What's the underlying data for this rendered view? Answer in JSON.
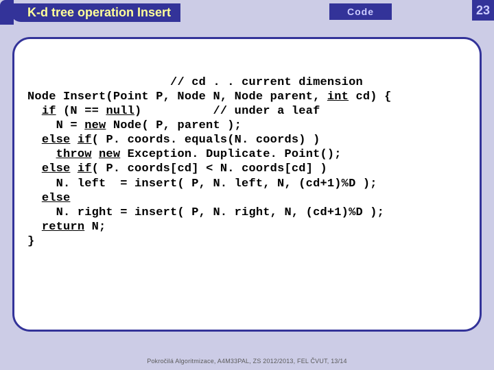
{
  "header": {
    "title": "K-d tree operation Insert",
    "code_label": "Code",
    "page_number": "23"
  },
  "code": {
    "pad": "                    ",
    "c1": "// cd . . current dimension",
    "l2": "Node Insert(Point P, Node N, Node parent, ",
    "kw_int": "int",
    "l2b": " cd) {",
    "pad3": "  ",
    "kw_if": "if",
    "l3a": " (N == ",
    "kw_null": "null",
    "l3b": ")          // under a leaf",
    "pad4": "    N = ",
    "kw_new": "new",
    "l4b": " Node( P, parent );",
    "pad5": "  ",
    "kw_else1": "else",
    "sp": " ",
    "kw_if2": "if",
    "l5b": "( P. coords. equals(N. coords) )",
    "pad6": "    ",
    "kw_throw": "throw",
    "kw_new2": "new",
    "l6b": " Exception. Duplicate. Point();",
    "pad7": "  ",
    "kw_else2": "else",
    "kw_if3": "if",
    "l7b": "( P. coords[cd] < N. coords[cd] )",
    "l8": "    N. left  = insert( P, N. left, N, (cd+1)%D );",
    "pad9": "  ",
    "kw_else3": "else",
    "l10": "    N. right = insert( P, N. right, N, (cd+1)%D );",
    "pad11": "  ",
    "kw_return": "return",
    "l11b": " N;",
    "l12": "}"
  },
  "footer": {
    "text": "Pokročilá Algoritmizace, A4M33PAL, ZS 2012/2013, FEL ČVUT, 13/14"
  }
}
